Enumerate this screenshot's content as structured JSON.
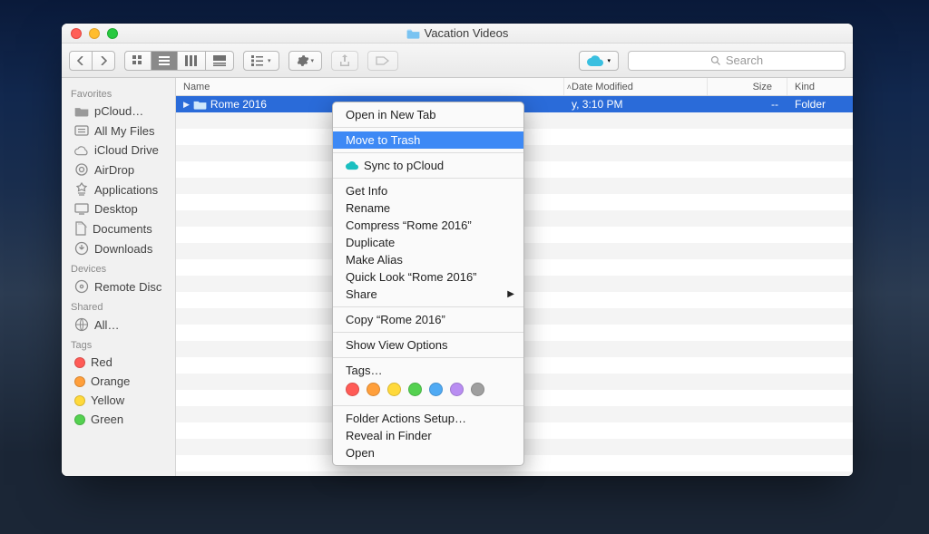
{
  "window": {
    "title": "Vacation Videos"
  },
  "toolbar": {
    "search_placeholder": "Search"
  },
  "columns": {
    "name": "Name",
    "date": "Date Modified",
    "size": "Size",
    "kind": "Kind"
  },
  "row": {
    "name": "Rome 2016",
    "date_visible": "y, 3:10 PM",
    "size": "--",
    "kind": "Folder"
  },
  "sidebar": {
    "favorites_hdr": "Favorites",
    "devices_hdr": "Devices",
    "shared_hdr": "Shared",
    "tags_hdr": "Tags",
    "favorites": [
      {
        "label": "pCloud…"
      },
      {
        "label": "All My Files"
      },
      {
        "label": "iCloud Drive"
      },
      {
        "label": "AirDrop"
      },
      {
        "label": "Applications"
      },
      {
        "label": "Desktop"
      },
      {
        "label": "Documents"
      },
      {
        "label": "Downloads"
      }
    ],
    "devices": [
      {
        "label": "Remote Disc"
      }
    ],
    "shared": [
      {
        "label": "All…"
      }
    ],
    "tags": [
      {
        "label": "Red",
        "color": "#ff5b56"
      },
      {
        "label": "Orange",
        "color": "#ff9f3b"
      },
      {
        "label": "Yellow",
        "color": "#ffd93b"
      },
      {
        "label": "Green",
        "color": "#54d150"
      }
    ]
  },
  "ctx": {
    "open_new_tab": "Open in New Tab",
    "move_to_trash": "Move to Trash",
    "sync_pcloud": "Sync to pCloud",
    "get_info": "Get Info",
    "rename": "Rename",
    "compress": "Compress “Rome 2016”",
    "duplicate": "Duplicate",
    "make_alias": "Make Alias",
    "quick_look": "Quick Look “Rome 2016”",
    "share": "Share",
    "copy": "Copy “Rome 2016”",
    "view_options": "Show View Options",
    "tags": "Tags…",
    "folder_actions": "Folder Actions Setup…",
    "reveal": "Reveal in Finder",
    "open": "Open",
    "tag_colors": [
      "#ff5b56",
      "#ff9f3b",
      "#ffd93b",
      "#54d150",
      "#4faaf4",
      "#b98df2",
      "#9f9f9f"
    ]
  }
}
